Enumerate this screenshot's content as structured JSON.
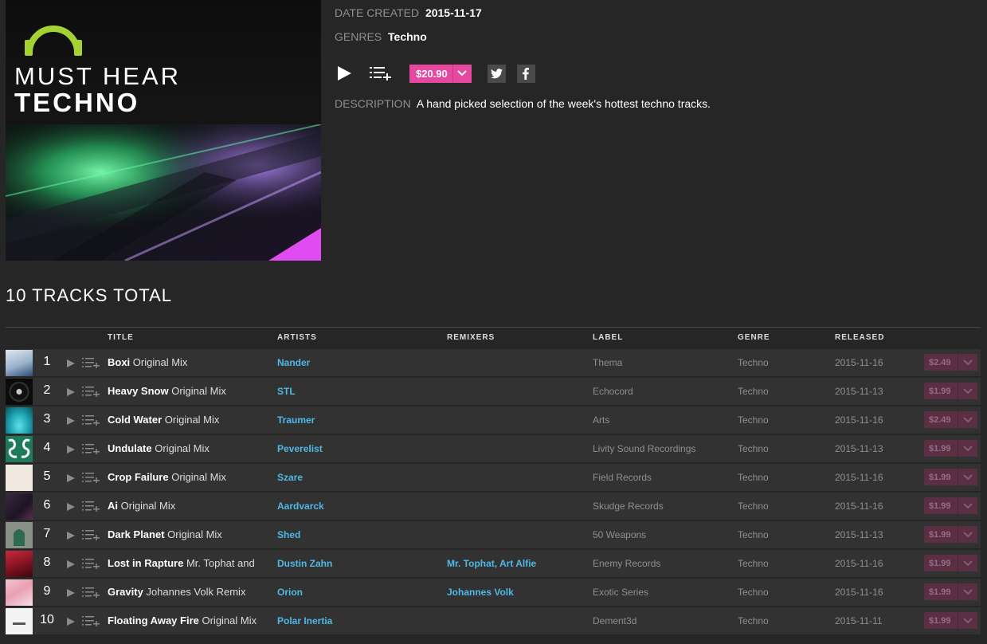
{
  "artwork": {
    "line1": "MUST HEAR",
    "line2": "TECHNO"
  },
  "meta": {
    "date_key": "DATE CREATED",
    "date_val": "2015-11-17",
    "genres_key": "GENRES",
    "genres_val": "Techno",
    "desc_key": "DESCRIPTION",
    "desc_val": "A hand picked selection of the week's hottest techno tracks."
  },
  "actions": {
    "price": "$20.90"
  },
  "tracks_total": "10 TRACKS TOTAL",
  "headers": {
    "title": "TITLE",
    "artists": "ARTISTS",
    "remixers": "REMIXERS",
    "label": "LABEL",
    "genre": "GENRE",
    "released": "RELEASED"
  },
  "colors": {
    "accent": "#e5489e",
    "link": "#4fb8e6",
    "row_bg": "#323232",
    "page_bg": "#262626"
  },
  "tracks": [
    {
      "num": "1",
      "name": "Boxi",
      "mix": "Original Mix",
      "artist": "Nander",
      "remixer": "",
      "label": "Thema",
      "genre": "Techno",
      "released": "2015-11-16",
      "price": "$2.49"
    },
    {
      "num": "2",
      "name": "Heavy Snow",
      "mix": "Original Mix",
      "artist": "STL",
      "remixer": "",
      "label": "Echocord",
      "genre": "Techno",
      "released": "2015-11-13",
      "price": "$1.99"
    },
    {
      "num": "3",
      "name": "Cold Water",
      "mix": "Original Mix",
      "artist": "Traumer",
      "remixer": "",
      "label": "Arts",
      "genre": "Techno",
      "released": "2015-11-16",
      "price": "$2.49"
    },
    {
      "num": "4",
      "name": "Undulate",
      "mix": "Original Mix",
      "artist": "Peverelist",
      "remixer": "",
      "label": "Livity Sound Recordings",
      "genre": "Techno",
      "released": "2015-11-13",
      "price": "$1.99"
    },
    {
      "num": "5",
      "name": "Crop Failure",
      "mix": "Original Mix",
      "artist": "Szare",
      "remixer": "",
      "label": "Field Records",
      "genre": "Techno",
      "released": "2015-11-16",
      "price": "$1.99"
    },
    {
      "num": "6",
      "name": "Ai",
      "mix": "Original Mix",
      "artist": "Aardvarck",
      "remixer": "",
      "label": "Skudge Records",
      "genre": "Techno",
      "released": "2015-11-16",
      "price": "$1.99"
    },
    {
      "num": "7",
      "name": "Dark Planet",
      "mix": "Original Mix",
      "artist": "Shed",
      "remixer": "",
      "label": "50 Weapons",
      "genre": "Techno",
      "released": "2015-11-13",
      "price": "$1.99"
    },
    {
      "num": "8",
      "name": "Lost in Rapture",
      "mix": "Mr. Tophat and",
      "artist": "Dustin Zahn",
      "remixer": "Mr. Tophat, Art Alfie",
      "label": "Enemy Records",
      "genre": "Techno",
      "released": "2015-11-16",
      "price": "$1.99"
    },
    {
      "num": "9",
      "name": "Gravity",
      "mix": "Johannes Volk Remix",
      "artist": "Orion",
      "remixer": "Johannes Volk",
      "label": "Exotic Series",
      "genre": "Techno",
      "released": "2015-11-16",
      "price": "$1.99"
    },
    {
      "num": "10",
      "name": "Floating Away Fire",
      "mix": "Original Mix",
      "artist": "Polar Inertia",
      "remixer": "",
      "label": "Dement3d",
      "genre": "Techno",
      "released": "2015-11-11",
      "price": "$1.99"
    }
  ]
}
